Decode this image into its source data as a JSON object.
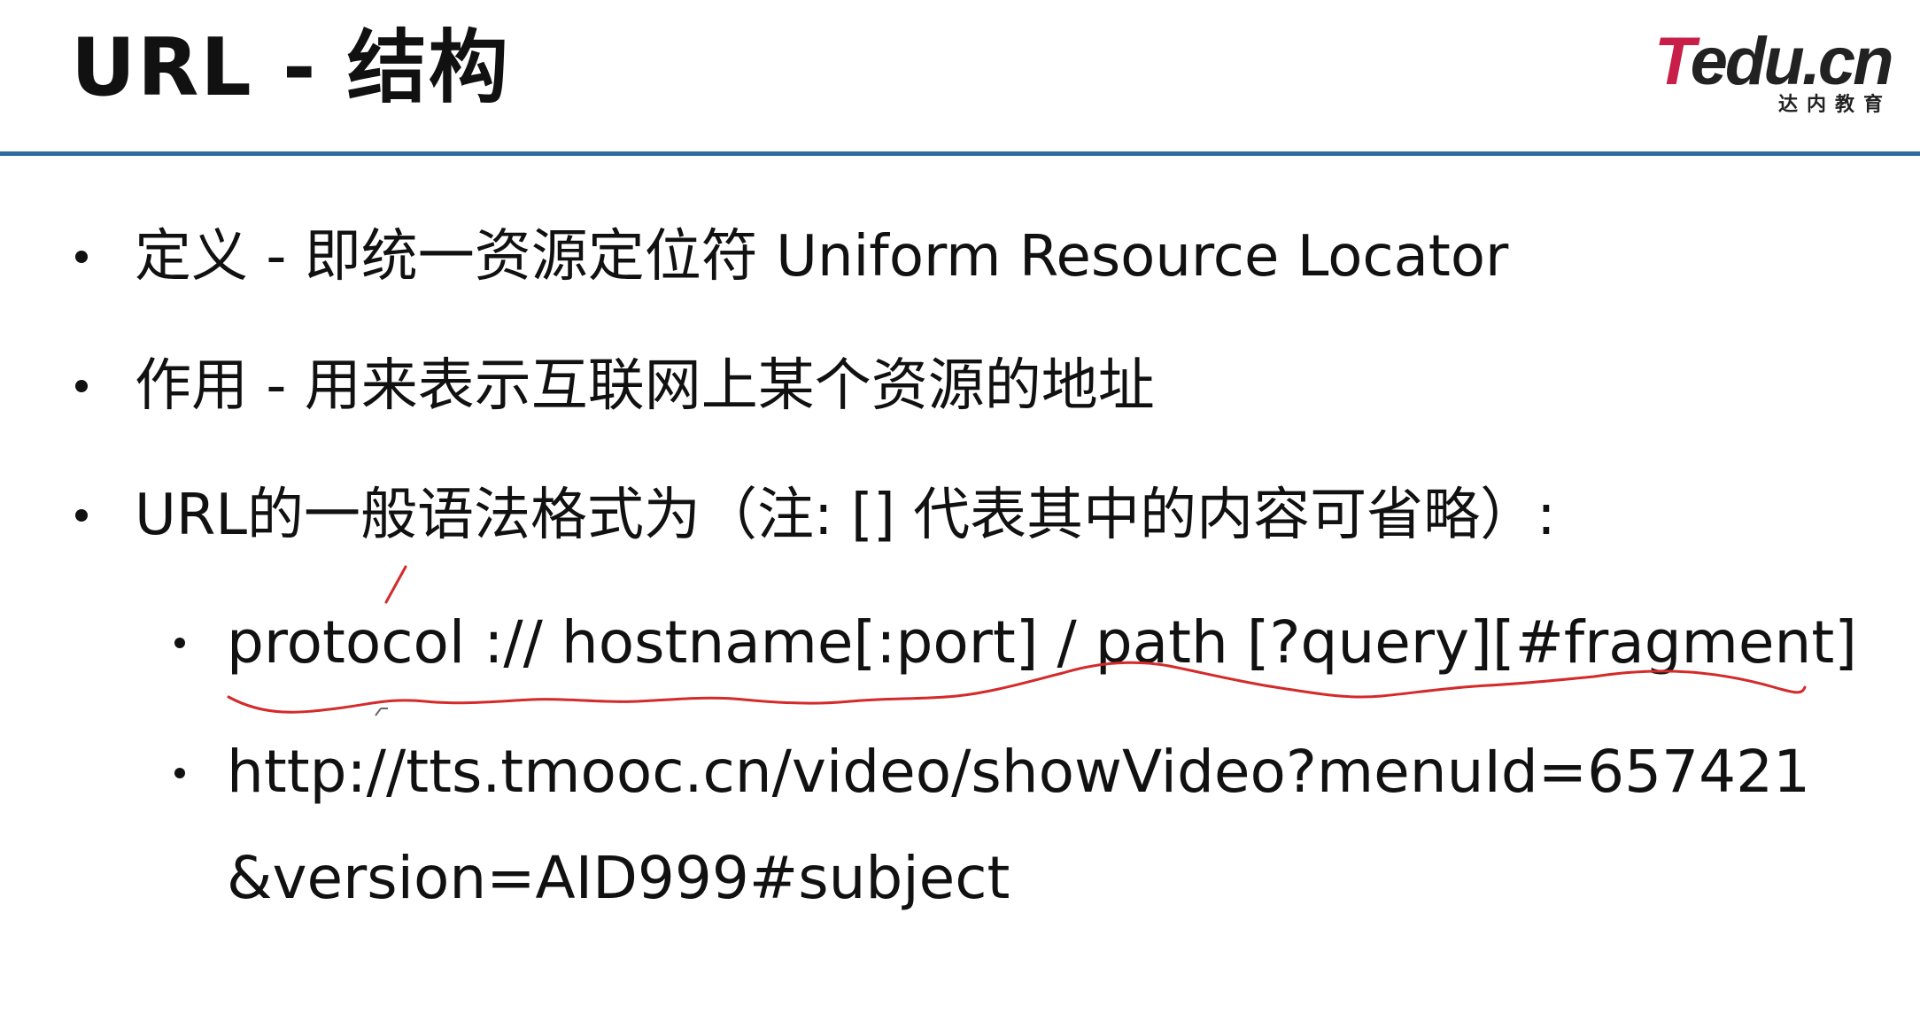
{
  "slide": {
    "title": "URL - 结构",
    "logo": {
      "brand_t": "T",
      "brand_rest": "edu.cn",
      "subtitle": "达内教育"
    },
    "bullets": [
      {
        "text": "定义 - 即统一资源定位符 Uniform Resource Locator"
      },
      {
        "text": "作用 - 用来表示互联网上某个资源的地址"
      },
      {
        "text": "URL的一般语法格式为（注: [] 代表其中的内容可省略）:"
      }
    ],
    "sub_bullets": [
      {
        "text": "protocol :// hostname[:port] / path [?query][#fragment]"
      },
      {
        "text": "http://tts.tmooc.cn/video/showVideo?menuId=657421",
        "continuation": "&version=AID999#subject"
      }
    ],
    "annotation_color": "#d42a2a"
  }
}
